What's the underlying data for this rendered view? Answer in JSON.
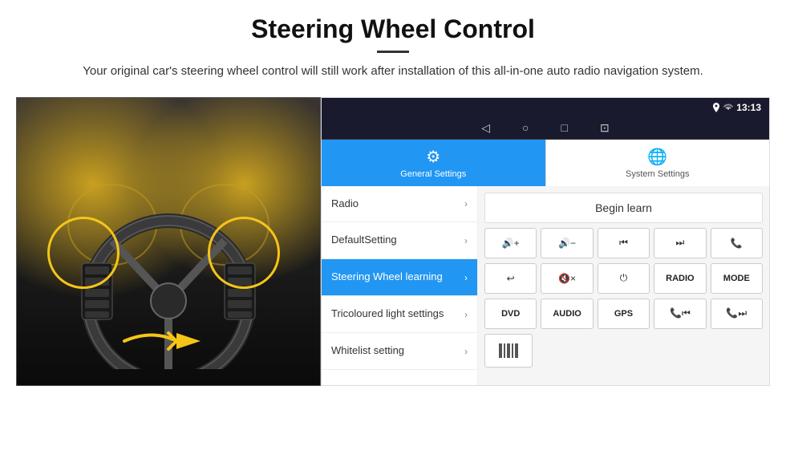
{
  "header": {
    "title": "Steering Wheel Control",
    "subtitle": "Your original car's steering wheel control will still work after installation of this all-in-one auto radio navigation system."
  },
  "statusBar": {
    "time": "13:13",
    "icons": [
      "location",
      "wifi",
      "signal"
    ]
  },
  "navBar": {
    "back": "◁",
    "home": "○",
    "recents": "□",
    "cast": "⊡"
  },
  "tabs": [
    {
      "id": "general",
      "label": "General Settings",
      "active": true,
      "icon": "⚙"
    },
    {
      "id": "system",
      "label": "System Settings",
      "active": false,
      "icon": "🌐"
    }
  ],
  "menuItems": [
    {
      "id": "radio",
      "label": "Radio",
      "active": false
    },
    {
      "id": "default",
      "label": "DefaultSetting",
      "active": false
    },
    {
      "id": "steering",
      "label": "Steering Wheel learning",
      "active": true
    },
    {
      "id": "tricoloured",
      "label": "Tricoloured light settings",
      "active": false
    },
    {
      "id": "whitelist",
      "label": "Whitelist setting",
      "active": false
    }
  ],
  "rightPanel": {
    "beginLearnBtn": "Begin learn",
    "buttons": {
      "row1": [
        {
          "label": "🔊+",
          "id": "vol-up"
        },
        {
          "label": "🔊−",
          "id": "vol-down"
        },
        {
          "label": "⏮",
          "id": "prev-track"
        },
        {
          "label": "⏭",
          "id": "next-track"
        },
        {
          "label": "📞",
          "id": "call"
        }
      ],
      "row2": [
        {
          "label": "↩",
          "id": "hang-up"
        },
        {
          "label": "🔇×",
          "id": "mute"
        },
        {
          "label": "⏻",
          "id": "power"
        },
        {
          "label": "RADIO",
          "id": "radio-btn"
        },
        {
          "label": "MODE",
          "id": "mode-btn"
        }
      ],
      "row3": [
        {
          "label": "DVD",
          "id": "dvd-btn"
        },
        {
          "label": "AUDIO",
          "id": "audio-btn"
        },
        {
          "label": "GPS",
          "id": "gps-btn"
        },
        {
          "label": "📞⏮",
          "id": "call-prev"
        },
        {
          "label": "📞⏭",
          "id": "call-next"
        }
      ],
      "row4scan": {
        "label": "≡",
        "id": "scan-btn"
      }
    }
  }
}
